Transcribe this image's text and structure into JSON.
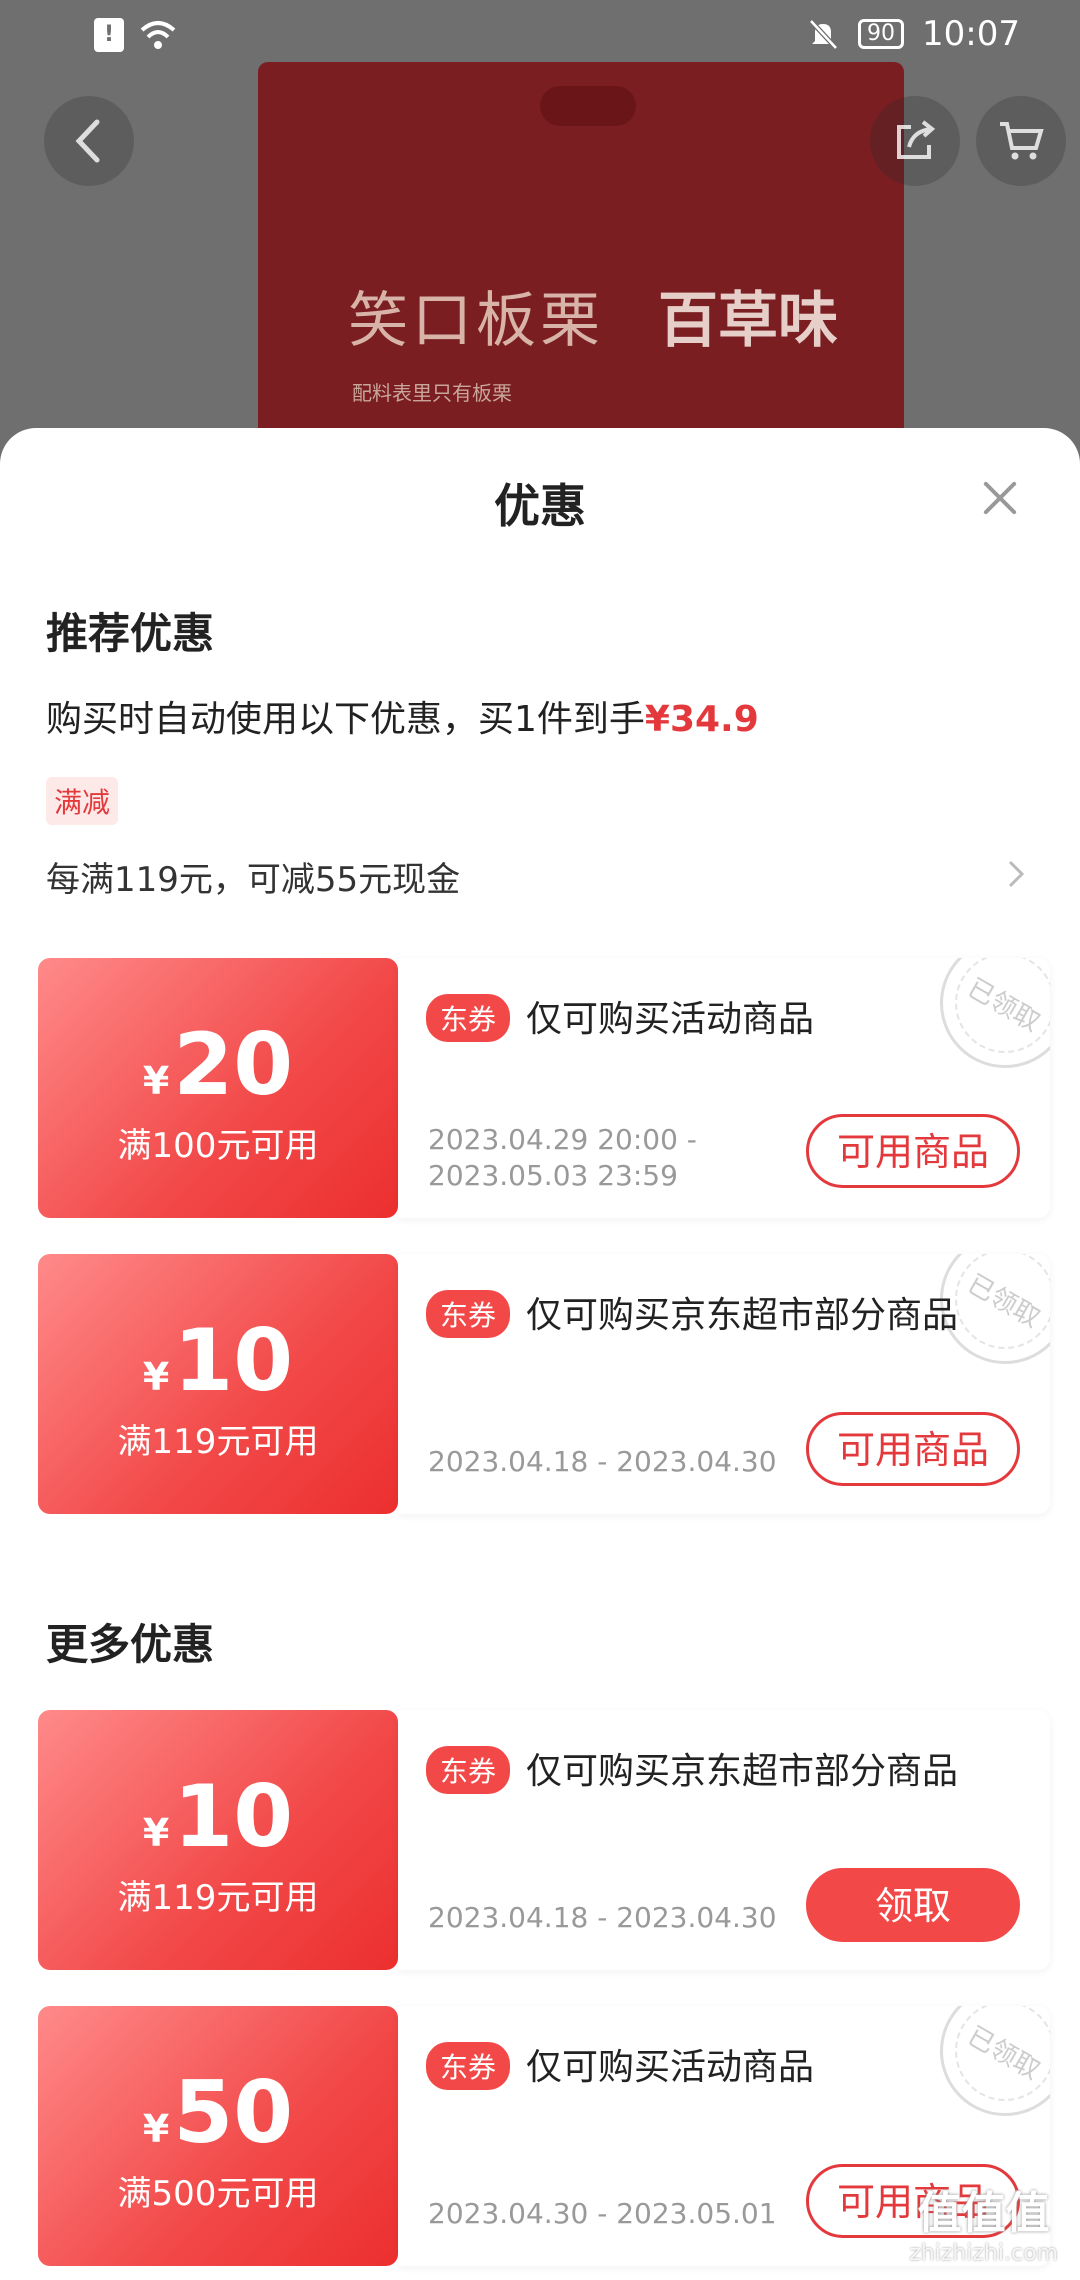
{
  "status_bar": {
    "time": "10:07",
    "battery": "90",
    "sim": "!"
  },
  "product": {
    "name": "笑口板栗",
    "brand": "百草味",
    "note": "配料表里只有板栗"
  },
  "sheet": {
    "title": "优惠",
    "recommended": {
      "title": "推荐优惠",
      "auto_prefix": "购买时自动使用以下优惠，买1件到手",
      "auto_price": "¥34.9",
      "reduce_tag": "满减",
      "reduce_desc": "每满119元，可减55元现金"
    },
    "more": {
      "title": "更多优惠"
    },
    "coupons": [
      {
        "yen": "¥",
        "amount": "20",
        "condition": "满100元可用",
        "badge": "东券",
        "title": "仅可购买活动商品",
        "date1": "2023.04.29 20:00 -",
        "date2": "2023.05.03 23:59",
        "button": "可用商品",
        "stamp": "已领取"
      },
      {
        "yen": "¥",
        "amount": "10",
        "condition": "满119元可用",
        "badge": "东券",
        "title": "仅可购买京东超市部分商品",
        "date1": "2023.04.18 - 2023.04.30",
        "button": "可用商品",
        "stamp": "已领取"
      },
      {
        "yen": "¥",
        "amount": "10",
        "condition": "满119元可用",
        "badge": "东券",
        "title": "仅可购买京东超市部分商品",
        "date1": "2023.04.18 - 2023.04.30",
        "button": "领取"
      },
      {
        "yen": "¥",
        "amount": "50",
        "condition": "满500元可用",
        "badge": "东券",
        "title": "仅可购买活动商品",
        "date1": "2023.04.30 - 2023.05.01",
        "button": "可用商品",
        "stamp": "已领取"
      }
    ]
  },
  "watermark": {
    "logo": "值值值",
    "url": "zhizhizhi.com"
  }
}
